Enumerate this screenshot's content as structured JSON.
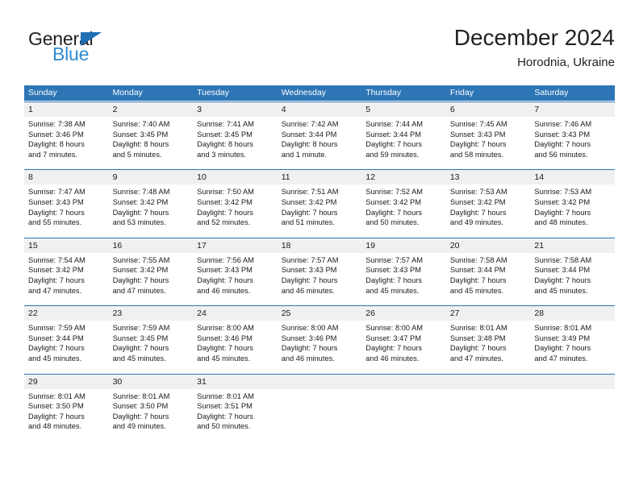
{
  "brand": {
    "name_dark": "General",
    "name_blue": "Blue",
    "accent_blue": "#2e75b6",
    "logo_blue": "#2e8bd0"
  },
  "header": {
    "title": "December 2024",
    "subtitle": "Horodnia, Ukraine"
  },
  "calendar": {
    "weekdays": [
      "Sunday",
      "Monday",
      "Tuesday",
      "Wednesday",
      "Thursday",
      "Friday",
      "Saturday"
    ],
    "weeks": [
      [
        {
          "day": "1",
          "sunrise": "Sunrise: 7:38 AM",
          "sunset": "Sunset: 3:46 PM",
          "daylight_1": "Daylight: 8 hours",
          "daylight_2": "and 7 minutes."
        },
        {
          "day": "2",
          "sunrise": "Sunrise: 7:40 AM",
          "sunset": "Sunset: 3:45 PM",
          "daylight_1": "Daylight: 8 hours",
          "daylight_2": "and 5 minutes."
        },
        {
          "day": "3",
          "sunrise": "Sunrise: 7:41 AM",
          "sunset": "Sunset: 3:45 PM",
          "daylight_1": "Daylight: 8 hours",
          "daylight_2": "and 3 minutes."
        },
        {
          "day": "4",
          "sunrise": "Sunrise: 7:42 AM",
          "sunset": "Sunset: 3:44 PM",
          "daylight_1": "Daylight: 8 hours",
          "daylight_2": "and 1 minute."
        },
        {
          "day": "5",
          "sunrise": "Sunrise: 7:44 AM",
          "sunset": "Sunset: 3:44 PM",
          "daylight_1": "Daylight: 7 hours",
          "daylight_2": "and 59 minutes."
        },
        {
          "day": "6",
          "sunrise": "Sunrise: 7:45 AM",
          "sunset": "Sunset: 3:43 PM",
          "daylight_1": "Daylight: 7 hours",
          "daylight_2": "and 58 minutes."
        },
        {
          "day": "7",
          "sunrise": "Sunrise: 7:46 AM",
          "sunset": "Sunset: 3:43 PM",
          "daylight_1": "Daylight: 7 hours",
          "daylight_2": "and 56 minutes."
        }
      ],
      [
        {
          "day": "8",
          "sunrise": "Sunrise: 7:47 AM",
          "sunset": "Sunset: 3:43 PM",
          "daylight_1": "Daylight: 7 hours",
          "daylight_2": "and 55 minutes."
        },
        {
          "day": "9",
          "sunrise": "Sunrise: 7:48 AM",
          "sunset": "Sunset: 3:42 PM",
          "daylight_1": "Daylight: 7 hours",
          "daylight_2": "and 53 minutes."
        },
        {
          "day": "10",
          "sunrise": "Sunrise: 7:50 AM",
          "sunset": "Sunset: 3:42 PM",
          "daylight_1": "Daylight: 7 hours",
          "daylight_2": "and 52 minutes."
        },
        {
          "day": "11",
          "sunrise": "Sunrise: 7:51 AM",
          "sunset": "Sunset: 3:42 PM",
          "daylight_1": "Daylight: 7 hours",
          "daylight_2": "and 51 minutes."
        },
        {
          "day": "12",
          "sunrise": "Sunrise: 7:52 AM",
          "sunset": "Sunset: 3:42 PM",
          "daylight_1": "Daylight: 7 hours",
          "daylight_2": "and 50 minutes."
        },
        {
          "day": "13",
          "sunrise": "Sunrise: 7:53 AM",
          "sunset": "Sunset: 3:42 PM",
          "daylight_1": "Daylight: 7 hours",
          "daylight_2": "and 49 minutes."
        },
        {
          "day": "14",
          "sunrise": "Sunrise: 7:53 AM",
          "sunset": "Sunset: 3:42 PM",
          "daylight_1": "Daylight: 7 hours",
          "daylight_2": "and 48 minutes."
        }
      ],
      [
        {
          "day": "15",
          "sunrise": "Sunrise: 7:54 AM",
          "sunset": "Sunset: 3:42 PM",
          "daylight_1": "Daylight: 7 hours",
          "daylight_2": "and 47 minutes."
        },
        {
          "day": "16",
          "sunrise": "Sunrise: 7:55 AM",
          "sunset": "Sunset: 3:42 PM",
          "daylight_1": "Daylight: 7 hours",
          "daylight_2": "and 47 minutes."
        },
        {
          "day": "17",
          "sunrise": "Sunrise: 7:56 AM",
          "sunset": "Sunset: 3:43 PM",
          "daylight_1": "Daylight: 7 hours",
          "daylight_2": "and 46 minutes."
        },
        {
          "day": "18",
          "sunrise": "Sunrise: 7:57 AM",
          "sunset": "Sunset: 3:43 PM",
          "daylight_1": "Daylight: 7 hours",
          "daylight_2": "and 46 minutes."
        },
        {
          "day": "19",
          "sunrise": "Sunrise: 7:57 AM",
          "sunset": "Sunset: 3:43 PM",
          "daylight_1": "Daylight: 7 hours",
          "daylight_2": "and 45 minutes."
        },
        {
          "day": "20",
          "sunrise": "Sunrise: 7:58 AM",
          "sunset": "Sunset: 3:44 PM",
          "daylight_1": "Daylight: 7 hours",
          "daylight_2": "and 45 minutes."
        },
        {
          "day": "21",
          "sunrise": "Sunrise: 7:58 AM",
          "sunset": "Sunset: 3:44 PM",
          "daylight_1": "Daylight: 7 hours",
          "daylight_2": "and 45 minutes."
        }
      ],
      [
        {
          "day": "22",
          "sunrise": "Sunrise: 7:59 AM",
          "sunset": "Sunset: 3:44 PM",
          "daylight_1": "Daylight: 7 hours",
          "daylight_2": "and 45 minutes."
        },
        {
          "day": "23",
          "sunrise": "Sunrise: 7:59 AM",
          "sunset": "Sunset: 3:45 PM",
          "daylight_1": "Daylight: 7 hours",
          "daylight_2": "and 45 minutes."
        },
        {
          "day": "24",
          "sunrise": "Sunrise: 8:00 AM",
          "sunset": "Sunset: 3:46 PM",
          "daylight_1": "Daylight: 7 hours",
          "daylight_2": "and 45 minutes."
        },
        {
          "day": "25",
          "sunrise": "Sunrise: 8:00 AM",
          "sunset": "Sunset: 3:46 PM",
          "daylight_1": "Daylight: 7 hours",
          "daylight_2": "and 46 minutes."
        },
        {
          "day": "26",
          "sunrise": "Sunrise: 8:00 AM",
          "sunset": "Sunset: 3:47 PM",
          "daylight_1": "Daylight: 7 hours",
          "daylight_2": "and 46 minutes."
        },
        {
          "day": "27",
          "sunrise": "Sunrise: 8:01 AM",
          "sunset": "Sunset: 3:48 PM",
          "daylight_1": "Daylight: 7 hours",
          "daylight_2": "and 47 minutes."
        },
        {
          "day": "28",
          "sunrise": "Sunrise: 8:01 AM",
          "sunset": "Sunset: 3:49 PM",
          "daylight_1": "Daylight: 7 hours",
          "daylight_2": "and 47 minutes."
        }
      ],
      [
        {
          "day": "29",
          "sunrise": "Sunrise: 8:01 AM",
          "sunset": "Sunset: 3:50 PM",
          "daylight_1": "Daylight: 7 hours",
          "daylight_2": "and 48 minutes."
        },
        {
          "day": "30",
          "sunrise": "Sunrise: 8:01 AM",
          "sunset": "Sunset: 3:50 PM",
          "daylight_1": "Daylight: 7 hours",
          "daylight_2": "and 49 minutes."
        },
        {
          "day": "31",
          "sunrise": "Sunrise: 8:01 AM",
          "sunset": "Sunset: 3:51 PM",
          "daylight_1": "Daylight: 7 hours",
          "daylight_2": "and 50 minutes."
        },
        {
          "day": "",
          "sunrise": "",
          "sunset": "",
          "daylight_1": "",
          "daylight_2": ""
        },
        {
          "day": "",
          "sunrise": "",
          "sunset": "",
          "daylight_1": "",
          "daylight_2": ""
        },
        {
          "day": "",
          "sunrise": "",
          "sunset": "",
          "daylight_1": "",
          "daylight_2": ""
        },
        {
          "day": "",
          "sunrise": "",
          "sunset": "",
          "daylight_1": "",
          "daylight_2": ""
        }
      ]
    ]
  }
}
